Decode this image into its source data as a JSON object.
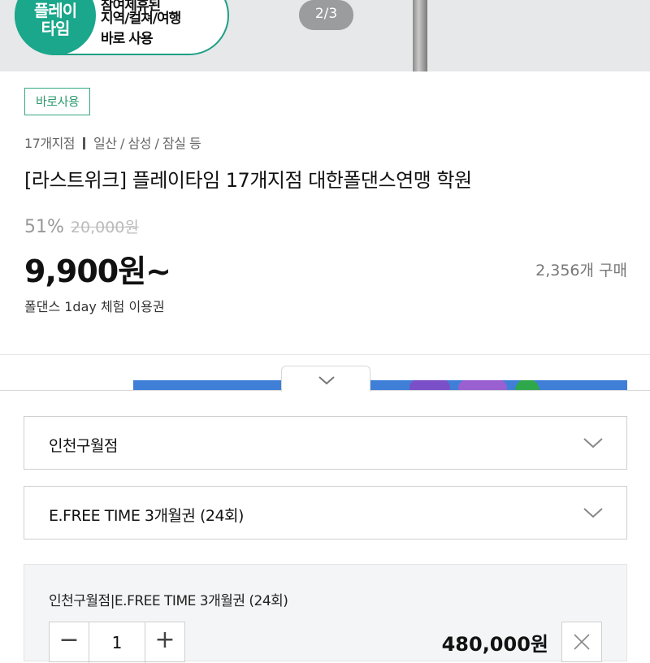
{
  "banner": {
    "badge_circle_text": "플레이\n타임",
    "badge_top_text": "참여제휴된",
    "badge_lines": [
      "지역/컬쳐/여행",
      "바로 사용"
    ],
    "page_indicator": "2/3"
  },
  "product": {
    "tag": "바로사용",
    "location_count": "17개지점",
    "location_areas": "일산 / 삼성 / 잠실 등",
    "title": "[라스트위크] 플레이타임 17개지점 대한폴댄스연맹 학원",
    "discount": "51%",
    "original_price": "20,000원",
    "price": "9,900원~",
    "purchase_count": "2,356개 구매",
    "subtitle": "폴댄스 1day 체험 이용권"
  },
  "options": {
    "branch_select": "인천구월점",
    "pass_select": "E.FREE TIME 3개월권 (24회)"
  },
  "selected_item": {
    "name": "인천구월점|E.FREE TIME 3개월권 (24회)",
    "quantity": "1",
    "minus": "−",
    "plus": "+",
    "price": "480,000원"
  },
  "colors": {
    "accent_green": "#1aa78b",
    "tag_green": "#36a87f"
  },
  "icons": {
    "handle": "chevron-down-icon",
    "select": "chevron-down-icon",
    "remove": "close-icon"
  }
}
